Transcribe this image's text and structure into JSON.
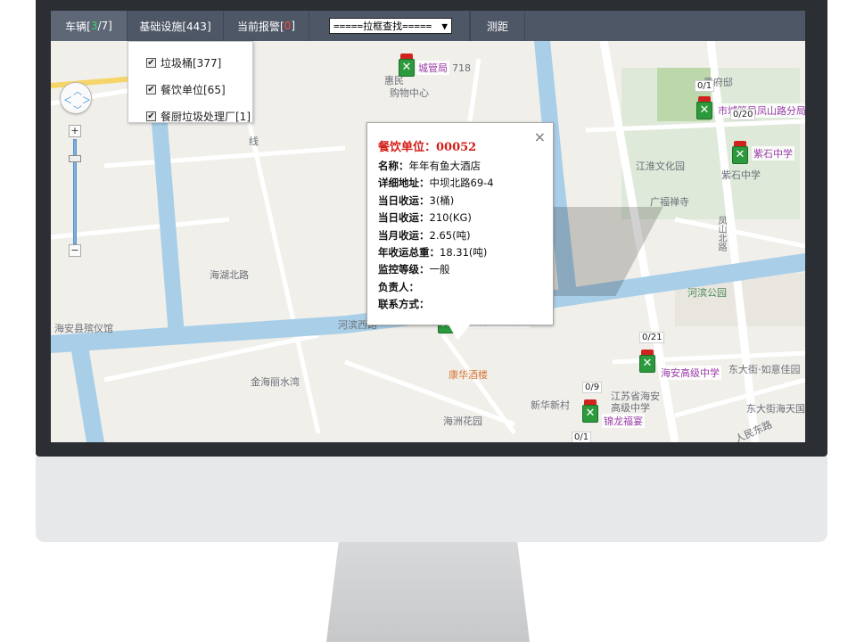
{
  "toolbar": {
    "vehicles_label": "车辆[",
    "vehicles_active": "3",
    "vehicles_total": "/7]",
    "facilities_label": "基础设施[443]",
    "alarm_label": "当前报警[",
    "alarm_count": "0",
    "alarm_suffix": "]",
    "select_value": "=====拉框查找=====",
    "measure_label": "测距"
  },
  "dropdown": {
    "items": [
      {
        "label": "垃圾桶[377]",
        "checked": true
      },
      {
        "label": "餐饮单位[65]",
        "checked": true
      },
      {
        "label": "餐厨垃圾处理厂[1]",
        "checked": true
      }
    ]
  },
  "info_window": {
    "title": "餐饮单位：00052",
    "close_label": "×",
    "rows": [
      {
        "key": "名称：",
        "value": "年年有鱼大酒店"
      },
      {
        "key": "详细地址：",
        "value": "中坝北路69-4"
      },
      {
        "key": "当日收运：",
        "value": "3(桶)"
      },
      {
        "key": "当日收运：",
        "value": "210(KG)"
      },
      {
        "key": "当月收运：",
        "value": "2.65(吨)"
      },
      {
        "key": "年收运总重：",
        "value": "18.31(吨)"
      },
      {
        "key": "监控等级：",
        "value": "一般"
      },
      {
        "key": "负责人：",
        "value": ""
      },
      {
        "key": "联系方式：",
        "value": ""
      }
    ]
  },
  "map": {
    "labels": {
      "road_hebin_west": "河滨西路",
      "road_haihu_north": "海湖北路",
      "funeral": "海安县殡仪馆",
      "jinhai": "金海丽水湾",
      "kanghua": "康华酒楼",
      "haizhou": "海洲花园",
      "xinhua": "新华新村",
      "jiangsu_haian": "江苏省海安高级中学",
      "hebin_park": "河滨公园",
      "jianghuai": "江淮文化园",
      "guangfu": "广福禅寺",
      "dongda_ruyi": "东大街·如意佳园",
      "dongda_haitian": "东大街海天国",
      "renmin_east": "人民东路",
      "fengshan_north": "凤山北路",
      "huimin": "惠民",
      "gouwu": "购物中心",
      "fuju": "凰府邸",
      "num_718": "718",
      "xian": "线",
      "ziyi": "紫石中学"
    },
    "poi_tags": {
      "chengguan": "城管局",
      "fengshan_branch": "市城管局凤山路分局",
      "zishi": "紫石中学",
      "niannian": "年年有鱼大酒店",
      "haian_high": "海安高级中学",
      "jinlong": "锦龙福宴"
    },
    "count_tags": {
      "a": "0/1",
      "b": "0/20",
      "c": "0/21",
      "d": "0/9",
      "e": "0/1"
    }
  }
}
